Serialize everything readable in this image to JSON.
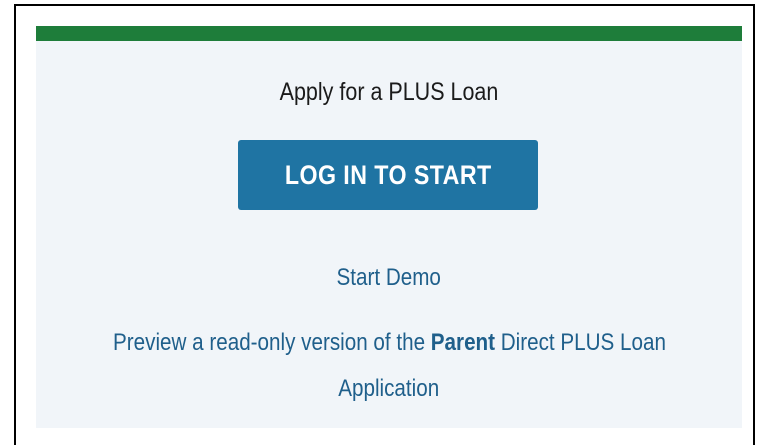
{
  "card": {
    "heading": "Apply for a PLUS Loan",
    "login_button_label": "LOG IN TO START",
    "demo_link": "Start Demo",
    "preview_link": {
      "before": "Preview a read-only version of the ",
      "bold": "Parent",
      "after_line1": " Direct PLUS Loan",
      "line2": "Application"
    }
  },
  "colors": {
    "accent_bar": "#1e7d3a",
    "button": "#1f74a3",
    "link": "#1f5f8b",
    "card_bg": "#f1f5f9"
  }
}
